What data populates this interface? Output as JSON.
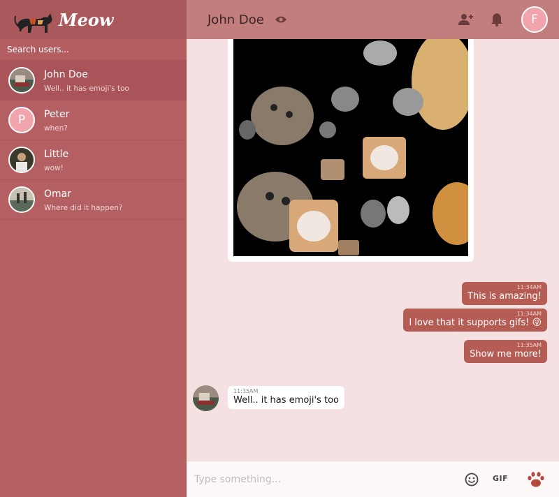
{
  "brand": {
    "name": "Meow"
  },
  "search": {
    "placeholder": "Search users..."
  },
  "users": [
    {
      "name": "John Doe",
      "preview": "Well.. it has emoji's too",
      "avatar": "photo"
    },
    {
      "name": "Peter",
      "preview": "when?",
      "avatar": "P"
    },
    {
      "name": "Little",
      "preview": "wow!",
      "avatar": "photo"
    },
    {
      "name": "Omar",
      "preview": "Where did it happen?",
      "avatar": "photo"
    }
  ],
  "header": {
    "title": "John Doe",
    "avatar_letter": "F",
    "icons": [
      "eye-icon",
      "add-user-icon",
      "bell-icon"
    ]
  },
  "messages": {
    "outgoing": [
      {
        "time": "11:34AM",
        "text": "This is amazing!"
      },
      {
        "time": "11:34AM",
        "text": "I love that it supports gifs! 😜"
      },
      {
        "time": "11:35AM",
        "text": "Show me more!"
      }
    ],
    "incoming": [
      {
        "time": "11:35AM",
        "text": "Well.. it has emoji's too"
      }
    ]
  },
  "composer": {
    "placeholder": "Type something...",
    "gif_label": "GIF",
    "icons": [
      "emoji-icon",
      "paw-icon"
    ]
  },
  "colors": {
    "sidebar": "#b45f62",
    "header": "#c27d7d",
    "chat_bg": "#f5e1e1",
    "bubble_out": "#b55d55",
    "avatar_pink": "#f2a4ad"
  }
}
